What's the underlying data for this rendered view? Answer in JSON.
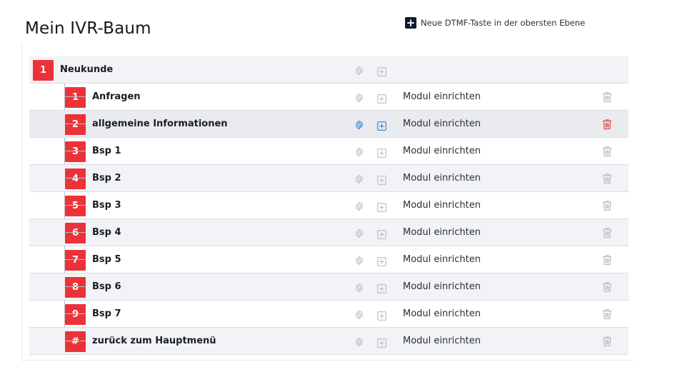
{
  "page": {
    "title": "Mein IVR-Baum"
  },
  "actions": {
    "add_root_label": "Neue DTMF-Taste in der obersten Ebene",
    "add_icon": "plus-square-icon"
  },
  "colors": {
    "badge": "#ec3238",
    "accent_blue": "#2f80d1",
    "delete_red": "#e5484d",
    "icon_gray": "#b8bcc4"
  },
  "tree": {
    "root": {
      "key": "1",
      "label": "Neukunde"
    },
    "children": [
      {
        "key": "1",
        "label": "Anfragen",
        "module": "Modul einrichten"
      },
      {
        "key": "2",
        "label": "allgemeine Informationen",
        "module": "Modul einrichten"
      },
      {
        "key": "3",
        "label": "Bsp 1",
        "module": "Modul einrichten"
      },
      {
        "key": "4",
        "label": "Bsp 2",
        "module": "Modul einrichten"
      },
      {
        "key": "5",
        "label": "Bsp 3",
        "module": "Modul einrichten"
      },
      {
        "key": "6",
        "label": "Bsp 4",
        "module": "Modul einrichten"
      },
      {
        "key": "7",
        "label": "Bsp 5",
        "module": "Modul einrichten"
      },
      {
        "key": "8",
        "label": "Bsp 6",
        "module": "Modul einrichten"
      },
      {
        "key": "9",
        "label": "Bsp 7",
        "module": "Modul einrichten"
      },
      {
        "key": "#",
        "label": "zurück zum Hauptmenü",
        "module": "Modul einrichten"
      }
    ]
  }
}
